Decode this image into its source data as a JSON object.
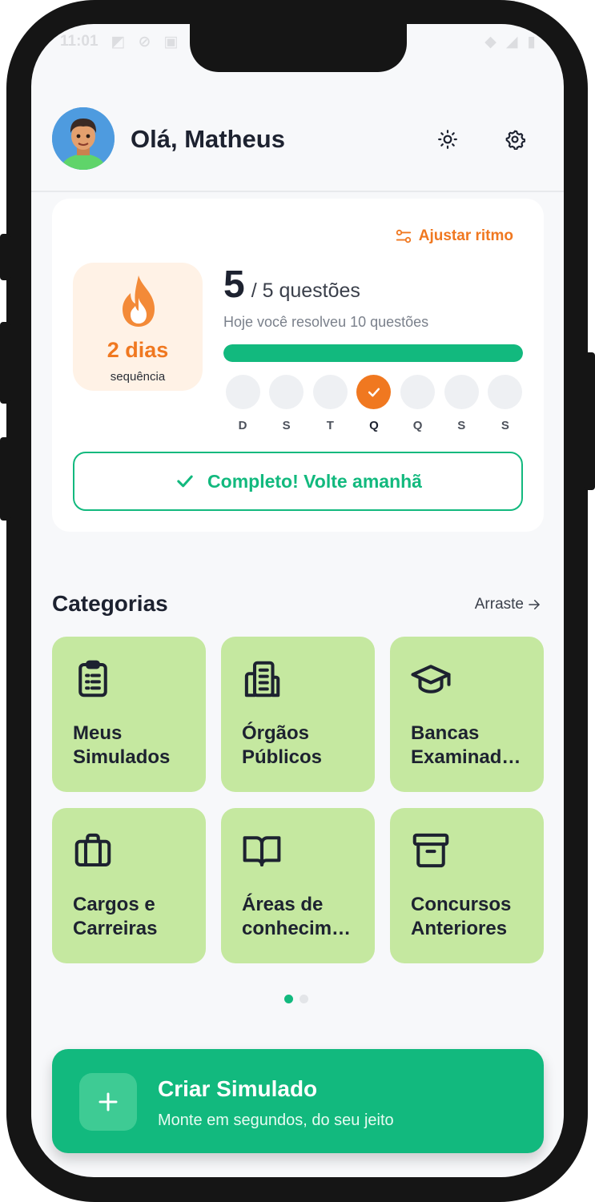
{
  "status_bar": {
    "time": "11:01"
  },
  "header": {
    "greeting": "Olá, Matheus",
    "theme_icon": "sun-icon",
    "settings_icon": "gear-icon"
  },
  "streak_card": {
    "adjust_label": "Ajustar ritmo",
    "streak_days": "2 dias",
    "streak_label": "sequência",
    "questions_done": "5",
    "questions_goal": "/ 5 questões",
    "today_text": "Hoje você resolveu 10 questões",
    "progress": 1.0,
    "week": [
      {
        "letter": "D",
        "done": false
      },
      {
        "letter": "S",
        "done": false
      },
      {
        "letter": "T",
        "done": false
      },
      {
        "letter": "Q",
        "done": true
      },
      {
        "letter": "Q",
        "done": false
      },
      {
        "letter": "S",
        "done": false
      },
      {
        "letter": "S",
        "done": false
      }
    ],
    "complete_label": "Completo! Volte amanhã"
  },
  "categories": {
    "title": "Categorias",
    "drag_hint": "Arraste",
    "items": [
      {
        "label": "Meus Simulados",
        "icon": "clipboard-icon"
      },
      {
        "label": "Órgãos Públicos",
        "icon": "building-icon"
      },
      {
        "label": "Bancas Examinad…",
        "icon": "graduation-cap-icon"
      },
      {
        "label": "Cargos e Carreiras",
        "icon": "briefcase-icon"
      },
      {
        "label": "Áreas de conhecim…",
        "icon": "book-icon"
      },
      {
        "label": "Concursos Anteriores",
        "icon": "archive-icon"
      }
    ],
    "page_count": 2,
    "current_page": 1
  },
  "cta": {
    "title": "Criar Simulado",
    "subtitle": "Monte em segundos, do seu jeito"
  },
  "colors": {
    "accent": "#12b97e",
    "orange": "#f07820",
    "category_bg": "#c5e8a0"
  }
}
